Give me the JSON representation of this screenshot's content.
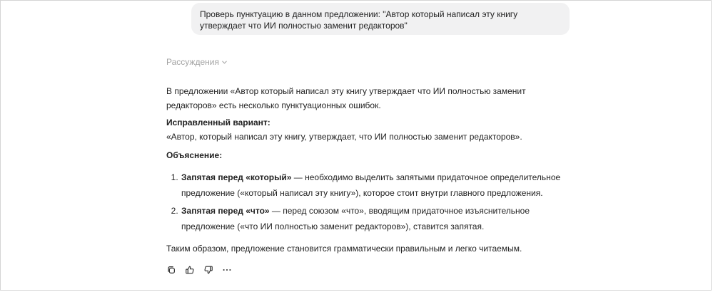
{
  "user_message": "Проверь пунктуацию в данном предложении: \"Автор который написал эту книгу утверждает что ИИ полностью заменит редакторов\"",
  "reasoning": {
    "label": "Рассуждения"
  },
  "answer": {
    "intro": "В предложении «Автор который написал эту книгу утверждает что ИИ полностью заменит редакторов» есть несколько пунктуационных ошибок.",
    "corrected_heading": "Исправленный вариант:",
    "corrected_text": "«Автор, который написал эту книгу, утверждает, что ИИ полностью заменит редакторов».",
    "explanation_heading": "Объяснение:",
    "points": [
      {
        "bold": "Запятая перед «который»",
        "text": " — необходимо выделить запятыми придаточное определительное предложение («который написал эту книгу»), которое стоит внутри главного предложения."
      },
      {
        "bold": "Запятая перед «что»",
        "text": " — перед союзом «что», вводящим придаточное изъяснительное предложение («что ИИ полностью заменит редакторов»), ставится запятая."
      }
    ],
    "conclusion": "Таким образом, предложение становится грамматически правильным и легко читаемым."
  },
  "actions": {
    "icons": [
      "copy-icon",
      "thumbs-up-icon",
      "thumbs-down-icon",
      "more-icon"
    ]
  }
}
